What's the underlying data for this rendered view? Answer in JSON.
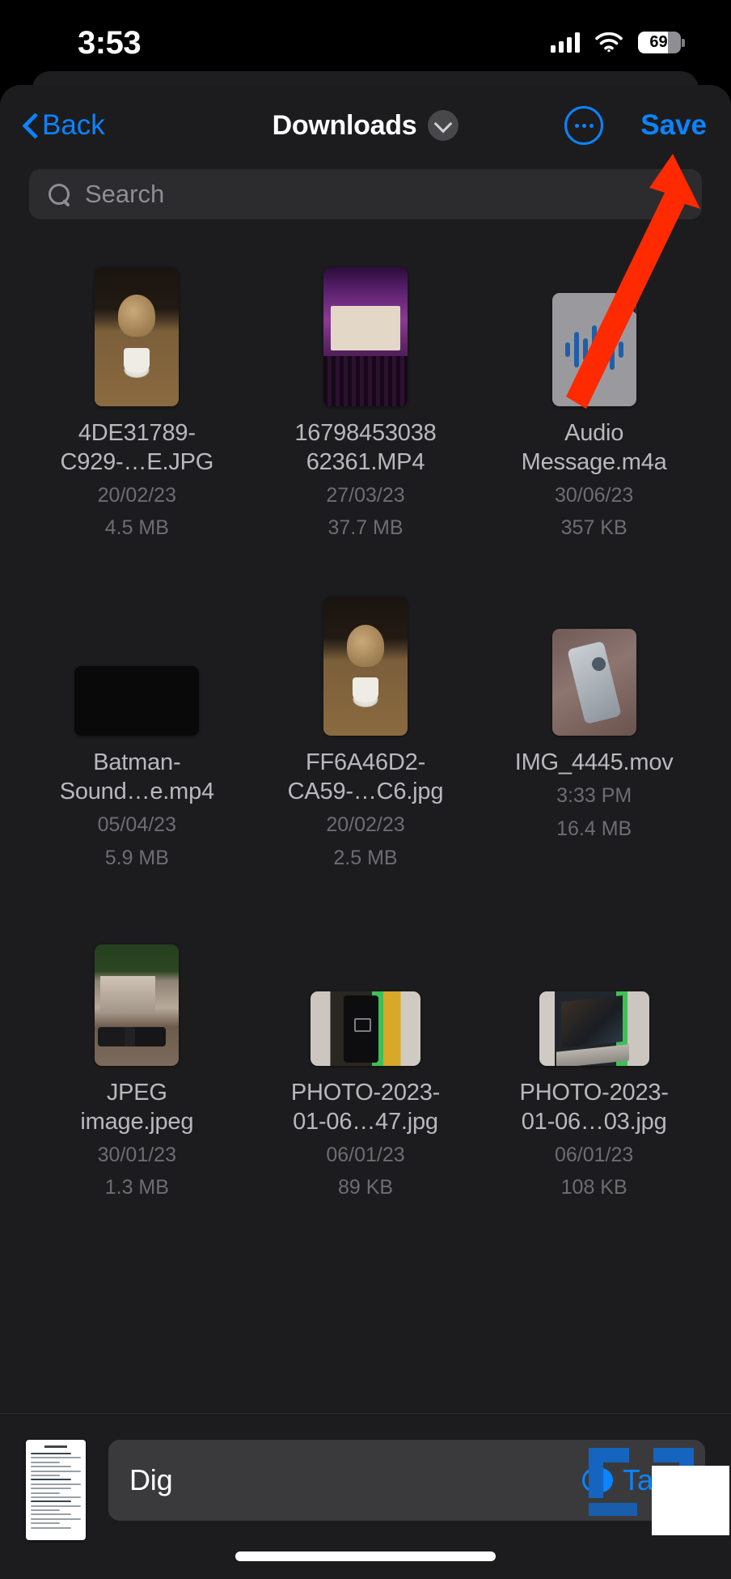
{
  "status_bar": {
    "time": "3:53",
    "cellular_icon": "cellular-bars-icon",
    "wifi_icon": "wifi-icon",
    "battery_percent": "69"
  },
  "nav": {
    "back_label": "Back",
    "title": "Downloads",
    "title_chevron_icon": "chevron-down-icon",
    "more_icon": "more-ellipsis-icon",
    "save_label": "Save"
  },
  "search": {
    "placeholder": "Search",
    "icon": "search-icon",
    "value": ""
  },
  "files": [
    {
      "name": "4DE31789-C929-…E.JPG",
      "date": "20/02/23",
      "size": "4.5 MB",
      "thumb": "groot-photo"
    },
    {
      "name": "16798453038 62361.MP4",
      "date": "27/03/23",
      "size": "37.7 MB",
      "thumb": "concert-video"
    },
    {
      "name": "Audio Message.m4a",
      "date": "30/06/23",
      "size": "357 KB",
      "thumb": "audio-waveform-document"
    },
    {
      "name": "Batman-Sound…e.mp4",
      "date": "05/04/23",
      "size": "5.9 MB",
      "thumb": "dark-video"
    },
    {
      "name": "FF6A46D2-CA59-…C6.jpg",
      "date": "20/02/23",
      "size": "2.5 MB",
      "thumb": "groot-photo"
    },
    {
      "name": "IMG_4445.mov",
      "date": "3:33 PM",
      "size": "16.4 MB",
      "thumb": "phone-photo"
    },
    {
      "name": "JPEG image.jpeg",
      "date": "30/01/23",
      "size": "1.3 MB",
      "thumb": "house-photo"
    },
    {
      "name": "PHOTO-2023-01-06…47.jpg",
      "date": "06/01/23",
      "size": "89 KB",
      "thumb": "hand-phone-photo"
    },
    {
      "name": "PHOTO-2023-01-06…03.jpg",
      "date": "06/01/23",
      "size": "108 KB",
      "thumb": "laptop-photo"
    }
  ],
  "bottom_bar": {
    "document_thumb_icon": "document-preview-icon",
    "filename_value": "Dig",
    "tags_label": "Tags",
    "tags_icon": "tags-icon"
  },
  "annotation": {
    "arrow_color": "#ff2a00",
    "points_to": "Save"
  },
  "colors": {
    "accent_blue": "#0a84ff",
    "sheet_background": "#1c1c1e",
    "field_background": "#2c2c2e",
    "secondary_text": "#8e8e93"
  }
}
